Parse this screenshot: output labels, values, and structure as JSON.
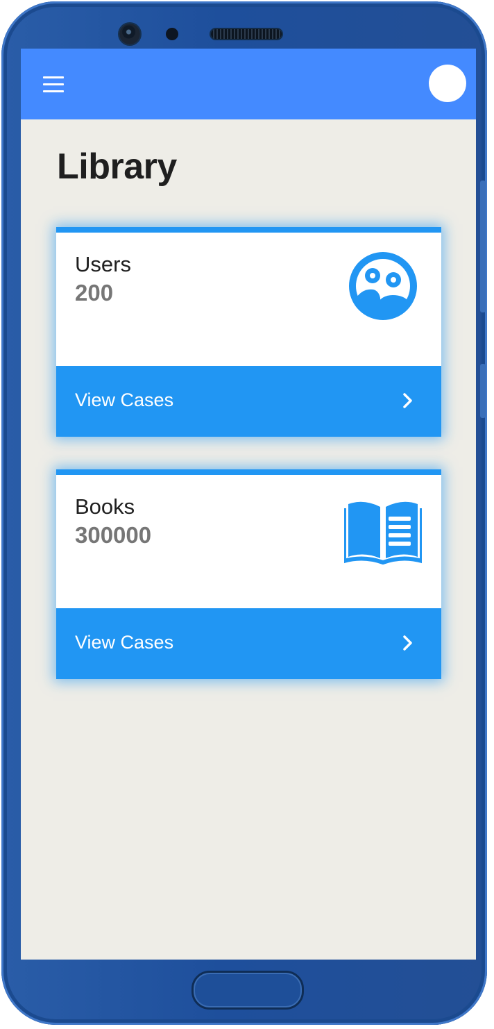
{
  "page": {
    "title": "Library"
  },
  "appbar": {
    "menu_icon": "hamburger-menu-icon",
    "avatar_icon": "avatar"
  },
  "cards": [
    {
      "label": "Users",
      "value": "200",
      "icon": "users-faces-icon",
      "footer_label": "View Cases",
      "footer_icon": "chevron-right-icon"
    },
    {
      "label": "Books",
      "value": "300000",
      "icon": "open-book-icon",
      "footer_label": "View Cases",
      "footer_icon": "chevron-right-icon"
    }
  ],
  "colors": {
    "appbar": "#448aff",
    "accent": "#2196f3",
    "background": "#eeede7",
    "device": "#1e4f9c"
  }
}
